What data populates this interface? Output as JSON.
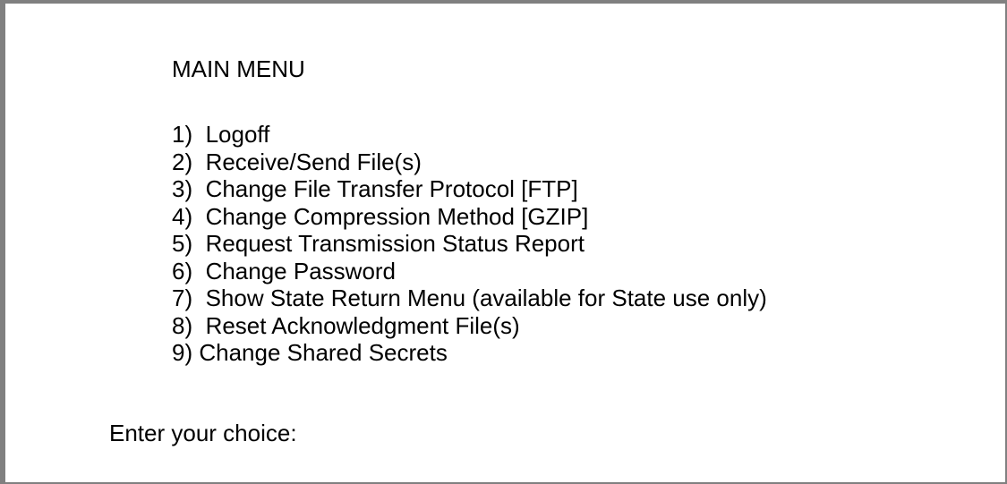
{
  "terminal": {
    "title": "MAIN MENU",
    "menu_items": [
      {
        "label": "1)  Logoff"
      },
      {
        "label": "2)  Receive/Send File(s)"
      },
      {
        "label": "3)  Change File Transfer Protocol [FTP]"
      },
      {
        "label": "4)  Change Compression Method [GZIP]"
      },
      {
        "label": "5)  Request Transmission Status Report"
      },
      {
        "label": "6)  Change Password"
      },
      {
        "label": "7)  Show State Return Menu (available for State use only)"
      },
      {
        "label": "8)  Reset Acknowledgment File(s)"
      },
      {
        "label": "9) Change Shared Secrets"
      }
    ],
    "prompt": "Enter your choice:",
    "input_value": ""
  },
  "colors": {
    "border": "#808080",
    "background": "#ffffff",
    "text": "#000000"
  }
}
